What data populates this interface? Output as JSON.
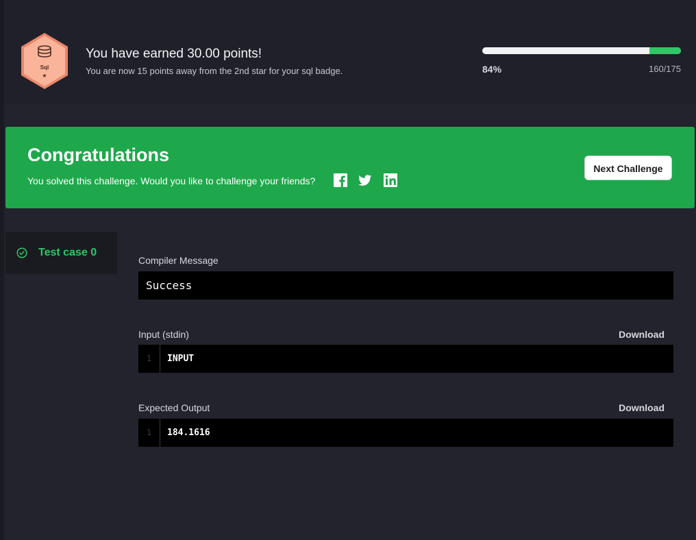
{
  "badge": {
    "label": "Sql",
    "icon": "database-icon",
    "colors": {
      "fill": "#f9b49a",
      "stroke": "#e8876a"
    }
  },
  "header": {
    "title": "You have earned 30.00 points!",
    "subtitle": "You are now 15 points away from the 2nd star for your sql badge.",
    "progress_percent_label": "84%",
    "progress_count": "160/175",
    "progress_fraction": 0.84
  },
  "banner": {
    "title": "Congratulations",
    "text": "You solved this challenge. Would you like to challenge your friends?",
    "next_button": "Next Challenge",
    "social": [
      "facebook-icon",
      "twitter-icon",
      "linkedin-icon"
    ],
    "color": "#1ea84b"
  },
  "testcase": {
    "label": "Test case 0",
    "status_icon": "check-circle-icon",
    "accent": "#2ec866"
  },
  "compiler": {
    "label": "Compiler Message",
    "value": "Success"
  },
  "input": {
    "label": "Input (stdin)",
    "download": "Download",
    "line_number": "1",
    "value": "INPUT"
  },
  "expected": {
    "label": "Expected Output",
    "download": "Download",
    "line_number": "1",
    "value": "184.1616"
  }
}
